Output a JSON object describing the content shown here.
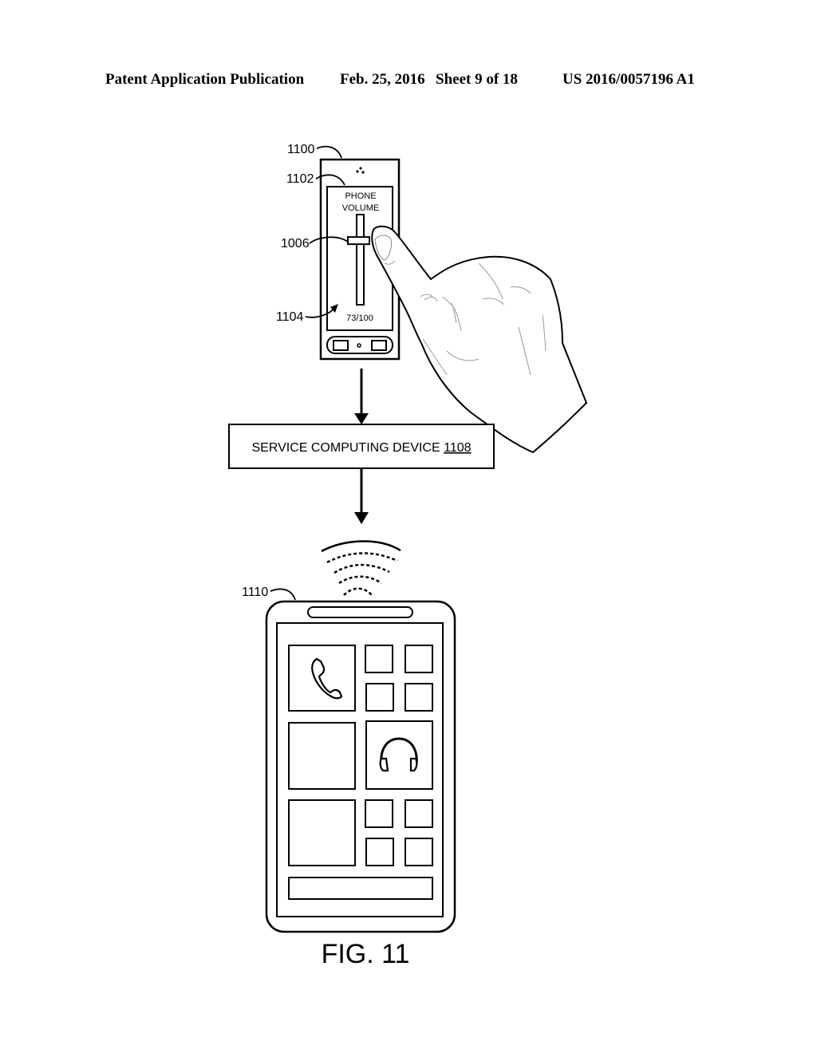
{
  "header": {
    "publication": "Patent Application Publication",
    "date": "Feb. 25, 2016",
    "sheet": "Sheet 9 of 18",
    "number": "US 2016/0057196 A1"
  },
  "figure": {
    "caption": "FIG. 11",
    "device_1100": {
      "ref": "1100",
      "screen_ref": "1102",
      "slider_ref": "1006",
      "gesture_ref": "1104",
      "screen_title_line1": "PHONE",
      "screen_title_line2": "VOLUME",
      "volume_readout": "73/100",
      "volume_fraction": 0.73
    },
    "service_box": {
      "label": "SERVICE COMPUTING DEVICE ",
      "ref": "1108"
    },
    "device_1110": {
      "ref": "1110",
      "tile_icons": [
        "phone-handset-icon",
        "headphones-icon"
      ]
    }
  }
}
